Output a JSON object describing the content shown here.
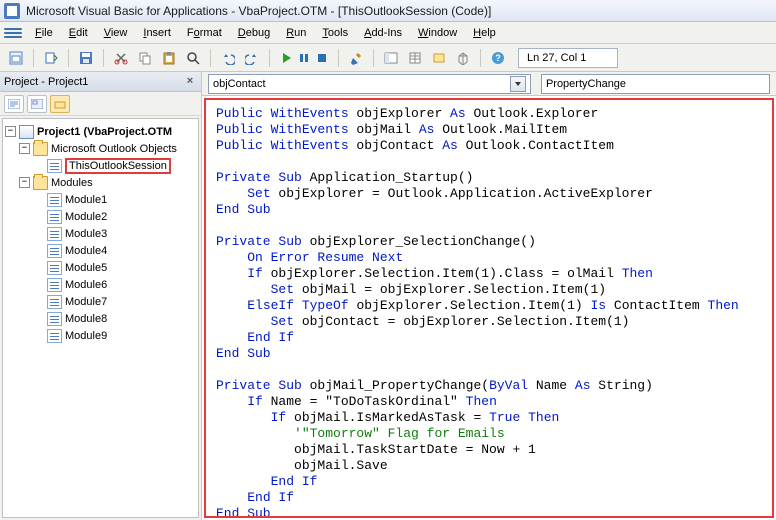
{
  "app": {
    "title": "Microsoft Visual Basic for Applications - VbaProject.OTM - [ThisOutlookSession (Code)]"
  },
  "menu": [
    "File",
    "Edit",
    "View",
    "Insert",
    "Format",
    "Debug",
    "Run",
    "Tools",
    "Add-Ins",
    "Window",
    "Help"
  ],
  "toolbar": {
    "cursor_position": "Ln 27, Col 1"
  },
  "project_panel": {
    "title": "Project - Project1",
    "root": "Project1 (VbaProject.OTM",
    "folder_outlook": "Microsoft Outlook Objects",
    "this_session": "ThisOutlookSession",
    "folder_modules": "Modules",
    "modules": [
      "Module1",
      "Module2",
      "Module3",
      "Module4",
      "Module5",
      "Module6",
      "Module7",
      "Module8",
      "Module9"
    ]
  },
  "code_header": {
    "object": "objContact",
    "procedure": "PropertyChange"
  },
  "code_fragments": {
    "kw_public_we": "Public WithEvents",
    "kw_as": "As",
    "kw_private_sub": "Private Sub",
    "kw_end_sub": "End Sub",
    "kw_set": "Set",
    "kw_on_error": "On Error Resume Next",
    "kw_if": "If",
    "kw_then": "Then",
    "kw_elseif": "ElseIf TypeOf",
    "kw_is": "Is",
    "kw_end_if": "End If",
    "kw_byval": "ByVal",
    "kw_true": "True",
    "decl_explorer": " objExplorer ",
    "type_explorer": " Outlook.Explorer",
    "decl_mail": " objMail ",
    "type_mail": " Outlook.MailItem",
    "decl_contact": " objContact ",
    "type_contact": " Outlook.ContactItem",
    "sub_startup": " Application_Startup()",
    "line_set_explorer": " objExplorer = Outlook.Application.ActiveExplorer",
    "sub_selchange": " objExplorer_SelectionChange()",
    "if_class": " objExplorer.Selection.Item(1).Class = olMail ",
    "set_mail": " objMail = objExplorer.Selection.Item(1)",
    "elseif_sel": " objExplorer.Selection.Item(1) ",
    "is_contact": " ContactItem ",
    "set_contact": " objContact = objExplorer.Selection.Item(1)",
    "sub_propchange_a": " objMail_PropertyChange(",
    "sub_propchange_b": " Name ",
    "sub_propchange_c": " String)",
    "if_name": " Name = \"ToDoTaskOrdinal\" ",
    "if_marked": " objMail.IsMarkedAsTask = ",
    "comment_flag": "'\"Tomorrow\" Flag for Emails",
    "line_startdate": "objMail.TaskStartDate = Now + 1",
    "line_save": "objMail.Save"
  }
}
